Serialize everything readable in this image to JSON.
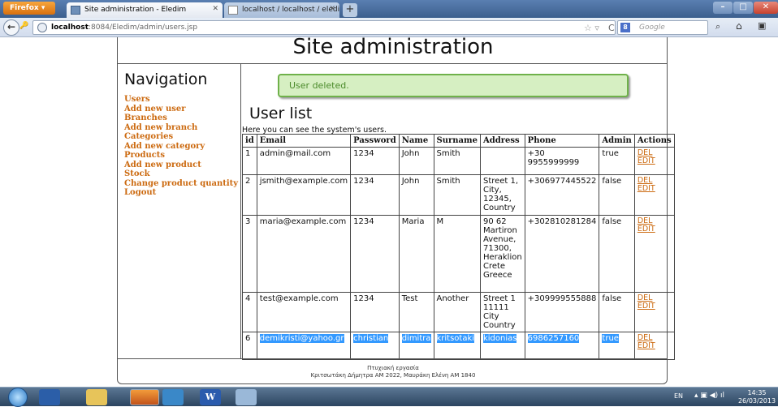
{
  "browser": {
    "menu_button": "Firefox ▾",
    "tabs": [
      {
        "title": "Site administration - Eledim"
      },
      {
        "title": "localhost / localhost / eledim / users |..."
      }
    ],
    "url_host": "localhost",
    "url_path": ":8084/Eledim/admin/users.jsp",
    "search_engine": "Google"
  },
  "site": {
    "title": "Site administration"
  },
  "navigation": {
    "title": "Navigation",
    "items": [
      {
        "label": "Users"
      },
      {
        "label": "Add new user"
      },
      {
        "label": "Branches"
      },
      {
        "label": "Add new branch"
      },
      {
        "label": "Categories"
      },
      {
        "label": "Add new category"
      },
      {
        "label": "Products"
      },
      {
        "label": "Add new product"
      },
      {
        "label": "Stock"
      },
      {
        "label": "Change product quantity"
      },
      {
        "label": "Logout"
      }
    ]
  },
  "main": {
    "alert": "User deleted.",
    "list_title": "User list",
    "description": "Here you can see the system's users.",
    "columns": [
      "id",
      "Email",
      "Password",
      "Name",
      "Surname",
      "Address",
      "Phone",
      "Admin",
      "Actions"
    ],
    "rows": [
      {
        "id": "1",
        "email": "admin@mail.com",
        "password": "1234",
        "name": "John",
        "surname": "Smith",
        "address": "",
        "phone": "+30 9955999999",
        "admin": "true",
        "del": "DEL",
        "edit": "EDIT"
      },
      {
        "id": "2",
        "email": "jsmith@example.com",
        "password": "1234",
        "name": "John",
        "surname": "Smith",
        "address": "Street 1, City, 12345, Country",
        "phone": "+306977445522",
        "admin": "false",
        "del": "DEL",
        "edit": "EDIT"
      },
      {
        "id": "3",
        "email": "maria@example.com",
        "password": "1234",
        "name": "Maria",
        "surname": "M",
        "address": "90 62 Martiron Avenue, 71300, Heraklion Crete Greece",
        "phone": "+302810281284",
        "admin": "false",
        "del": "DEL",
        "edit": "EDIT"
      },
      {
        "id": "4",
        "email": "test@example.com",
        "password": "1234",
        "name": "Test",
        "surname": "Another",
        "address": "Street 1 11111 City Country",
        "phone": "+309999555888",
        "admin": "false",
        "del": "DEL",
        "edit": "EDIT"
      },
      {
        "id": "6",
        "email": "demikristi@yahoo.gr",
        "password": "christian",
        "name": "dimitra",
        "surname": "kritsotaki",
        "address": "kidonias",
        "phone": "6986257160",
        "admin": "true",
        "del": "DEL",
        "edit": "EDIT"
      }
    ]
  },
  "footer": {
    "line1": "Πτυχιακή εργασία",
    "line2": "Κριτσωτάκη Δήμητρα ΑΜ 2022, Μαυράκη Ελένη ΑΜ 1840"
  },
  "taskbar": {
    "language": "EN",
    "time": "14:35",
    "date": "26/03/2013"
  },
  "colors": {
    "link": "#cc6a10",
    "alert_bg": "#d6efc2",
    "alert_border": "#6fb14a",
    "selection": "#3399ff"
  }
}
